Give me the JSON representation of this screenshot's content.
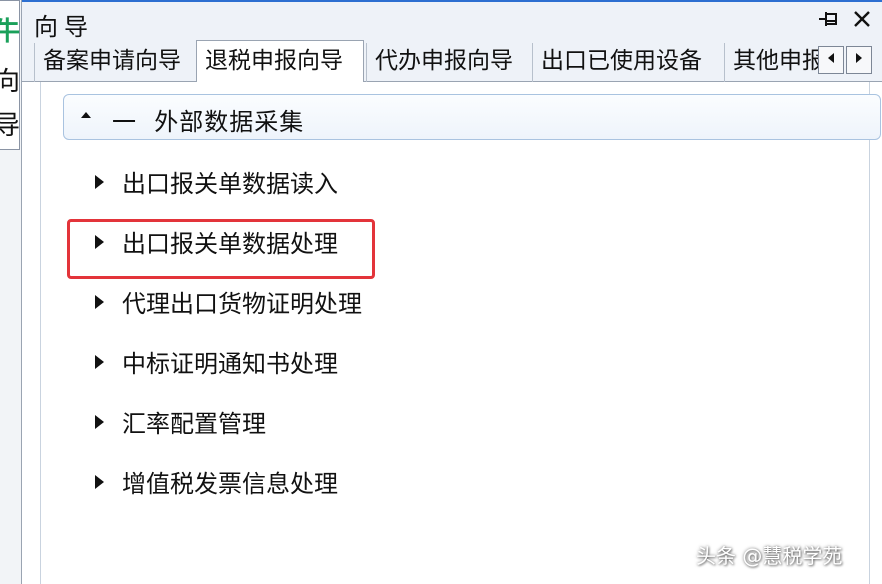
{
  "left_strip": {
    "glyphs": [
      "牛",
      "向",
      "导"
    ],
    "accent_color": "#1aa05a"
  },
  "window": {
    "title": "向导",
    "pin_icon": "pin-icon",
    "close_icon": "close-icon"
  },
  "tabs": [
    {
      "label": "备案申请向导",
      "active": false
    },
    {
      "label": "退税申报向导",
      "active": true
    },
    {
      "label": "代办申报向导",
      "active": false
    },
    {
      "label": "出口已使用设备",
      "active": false
    },
    {
      "label": "其他申报",
      "active": false
    }
  ],
  "tab_scroll": {
    "left_icon": "triangle-left-icon",
    "right_icon": "triangle-right-icon"
  },
  "group": {
    "label": "外部数据采集",
    "collapse_symbol": "一",
    "expanded": true
  },
  "items": [
    {
      "label": "出口报关单数据读入"
    },
    {
      "label": "出口报关单数据处理",
      "highlighted": true
    },
    {
      "label": "代理出口货物证明处理"
    },
    {
      "label": "中标证明通知书处理"
    },
    {
      "label": "汇率配置管理"
    },
    {
      "label": "增值税发票信息处理"
    }
  ],
  "highlight_color": "#e3343a",
  "watermark": "头条 @慧税学苑"
}
